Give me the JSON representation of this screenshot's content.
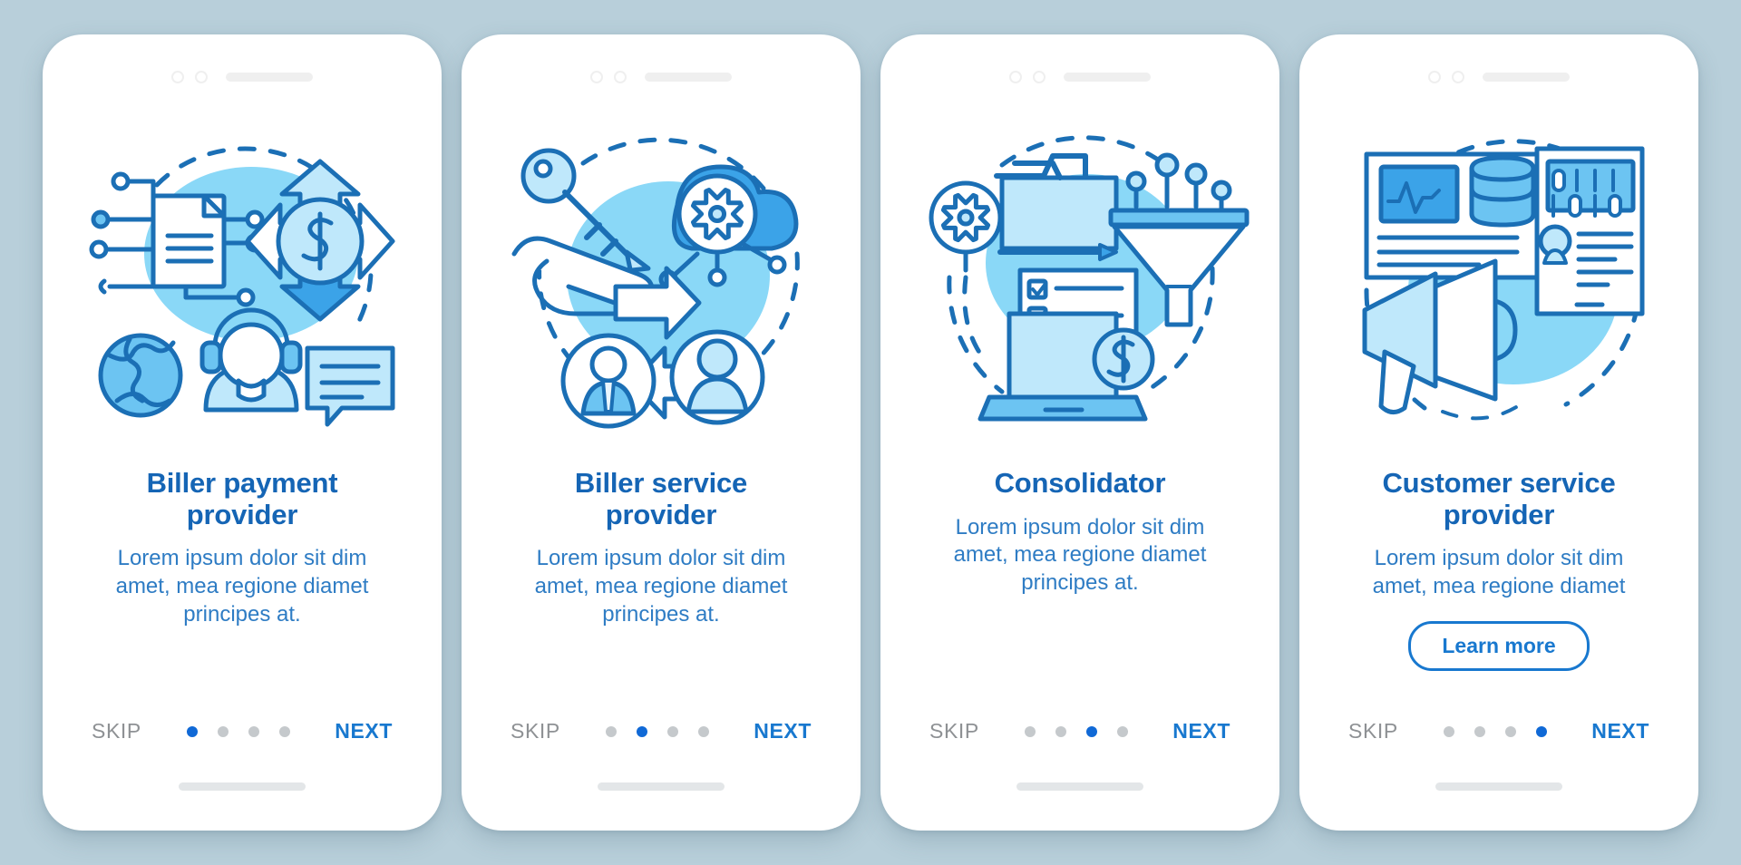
{
  "theme": {
    "page_background": "#b8cfda",
    "card_background": "#ffffff",
    "title_color": "#1565b5",
    "desc_color": "#2e7cc4",
    "accent_blue": "#1878cf",
    "skip_color": "#8e9194",
    "dot_inactive": "#c5c9cc",
    "dot_active": "#1069d6",
    "blob_color": "#8ad8f7",
    "line_blue": "#1b6fb5",
    "fill_light": "#bfe8fb",
    "fill_mid": "#6cc4f2",
    "fill_dark": "#3ba3e8"
  },
  "screens": [
    {
      "id": "screen-biller-payment-provider",
      "title": "Biller payment provider",
      "title_lines": [
        "Biller payment",
        "provider"
      ],
      "description": "Lorem ipsum dolor sit dim amet, mea regione diamet principes at.",
      "desc_lines": [
        "Lorem ipsum dolor sit dim",
        "amet, mea regione diamet",
        "principes at."
      ],
      "has_learn_more": false,
      "learn_more_label": "",
      "skip_label": "SKIP",
      "next_label": "NEXT",
      "dots_total": 4,
      "dot_active_index": 0,
      "illustration": "biller-payment-illustration",
      "illustration_elements": [
        "document-node-icon",
        "dollar-arrows-icon",
        "globe-icon",
        "headset-operator-icon",
        "chat-bubble-icon",
        "dashed-arc"
      ]
    },
    {
      "id": "screen-biller-service-provider",
      "title": "Biller service provider",
      "title_lines": [
        "Biller service",
        "provider"
      ],
      "description": "Lorem ipsum dolor sit dim amet, mea regione diamet principes at.",
      "desc_lines": [
        "Lorem ipsum dolor sit dim",
        "amet, mea regione diamet",
        "principes at."
      ],
      "has_learn_more": false,
      "learn_more_label": "",
      "skip_label": "SKIP",
      "next_label": "NEXT",
      "dots_total": 4,
      "dot_active_index": 1,
      "illustration": "biller-service-illustration",
      "illustration_elements": [
        "key-icon",
        "open-hand-icon",
        "cloud-gear-icon",
        "right-arrow-icon",
        "left-arrow-icon",
        "user-tie-avatar-icon",
        "user-avatar-icon",
        "dashed-circle"
      ]
    },
    {
      "id": "screen-consolidator",
      "title": "Consolidator",
      "title_lines": [
        "Consolidator"
      ],
      "description": "Lorem ipsum dolor sit dim amet, mea regione diamet principes at.",
      "desc_lines": [
        "Lorem ipsum dolor sit dim",
        "amet, mea regione diamet",
        "principes at."
      ],
      "has_learn_more": false,
      "learn_more_label": "",
      "skip_label": "SKIP",
      "next_label": "NEXT",
      "dots_total": 4,
      "dot_active_index": 2,
      "illustration": "consolidator-illustration",
      "illustration_elements": [
        "gear-icon",
        "folder-icon",
        "funnel-icon",
        "checklist-icon",
        "laptop-icon",
        "dollar-coin-icon",
        "dashed-arc"
      ]
    },
    {
      "id": "screen-customer-service-provider",
      "title": "Customer service provider",
      "title_lines": [
        "Customer service",
        "provider"
      ],
      "description": "Lorem ipsum dolor sit dim amet, mea regione diamet",
      "desc_lines": [
        "Lorem ipsum dolor sit dim",
        "amet, mea regione diamet"
      ],
      "has_learn_more": true,
      "learn_more_label": "Learn more",
      "skip_label": "SKIP",
      "next_label": "NEXT",
      "dots_total": 4,
      "dot_active_index": 3,
      "illustration": "customer-service-illustration",
      "illustration_elements": [
        "dashboard-card-icon",
        "chart-icon",
        "database-icon",
        "binary-tablet-icon",
        "contact-card-icon",
        "megaphone-icon",
        "dashed-circle"
      ]
    }
  ]
}
